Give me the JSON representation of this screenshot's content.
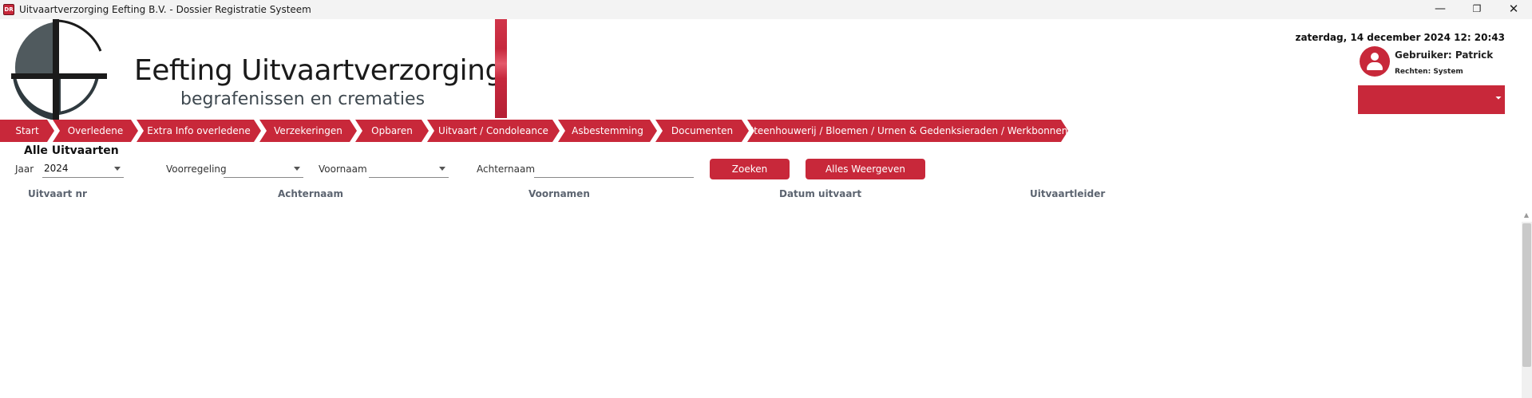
{
  "window": {
    "title": "Uitvaartverzorging Eefting B.V. - Dossier Registratie Systeem",
    "icon_text": "DR",
    "min_symbol": "—",
    "max_symbol": "❐",
    "close_symbol": "✕"
  },
  "logo": {
    "name": "Eefting Uitvaartverzorging",
    "tagline": "begrafenissen en crematies"
  },
  "header": {
    "datetime": "zaterdag, 14 december 2024 12: 20:43",
    "user_label": "Gebruiker: Patrick",
    "rights_label": "Rechten: System",
    "dropdown_chevron": "⏷"
  },
  "nav": {
    "items": [
      "Start",
      "Overledene",
      "Extra Info overledene",
      "Verzekeringen",
      "Opbaren",
      "Uitvaart / Condoleance",
      "Asbestemming",
      "Documenten",
      "Steenhouwerij / Bloemen / Urnen & Gedenksieraden / Werkbonnen"
    ]
  },
  "section": {
    "title": "Alle Uitvaarten"
  },
  "filters": {
    "jaar_label": "Jaar",
    "jaar_value": "2024",
    "voorregeling_label": "Voorregeling",
    "voorregeling_value": "",
    "voornaam_label": "Voornaam",
    "voornaam_value": "",
    "achternaam_label": "Achternaam",
    "achternaam_value": "",
    "zoeken_label": "Zoeken",
    "alles_label": "Alles Weergeven"
  },
  "table": {
    "columns": [
      "Uitvaart nr",
      "Achternaam",
      "Voornamen",
      "Datum uitvaart",
      "Uitvaartleider"
    ],
    "rows": []
  },
  "scrollbar": {
    "up_symbol": "▲"
  },
  "colors": {
    "accent": "#c8283a",
    "logo_dark": "#2f3a3f"
  }
}
